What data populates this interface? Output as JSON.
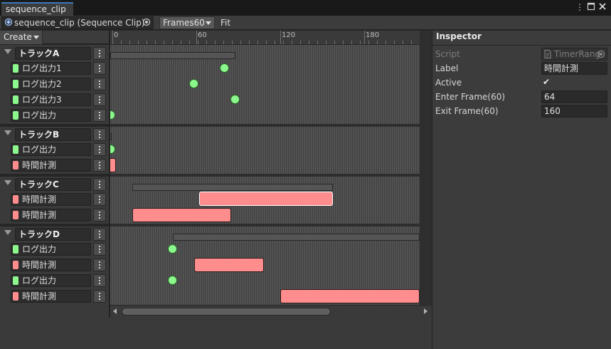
{
  "window": {
    "tab_title": "sequence_clip",
    "menu_icon": "kebab-menu-icon",
    "maximize_icon": "maximize-icon",
    "close_icon": "close-icon"
  },
  "toolbar": {
    "asset_field": "sequence_clip (Sequence Clip)",
    "frame_rate_dropdown": "Frames60",
    "fit_button": "Fit"
  },
  "left_header": {
    "create_button": "Create"
  },
  "ruler": {
    "ticks": [
      "0",
      "60",
      "120",
      "180"
    ]
  },
  "tracks": [
    {
      "name": "トラックA",
      "events": [
        {
          "label": "ログ出力1",
          "kind": "log",
          "color": "#8cf78c"
        },
        {
          "label": "ログ出力2",
          "kind": "log",
          "color": "#8cf78c"
        },
        {
          "label": "ログ出力3",
          "kind": "log",
          "color": "#8cf78c"
        },
        {
          "label": "ログ出力",
          "kind": "log",
          "color": "#8cf78c"
        }
      ]
    },
    {
      "name": "トラックB",
      "events": [
        {
          "label": "ログ出力",
          "kind": "log",
          "color": "#8cf78c"
        },
        {
          "label": "時間計測",
          "kind": "timer",
          "color": "#ff8d8d"
        }
      ]
    },
    {
      "name": "トラックC",
      "events": [
        {
          "label": "時間計測",
          "kind": "timer",
          "color": "#ff8d8d"
        },
        {
          "label": "時間計測",
          "kind": "timer",
          "color": "#ff8d8d"
        }
      ]
    },
    {
      "name": "トラックD",
      "events": [
        {
          "label": "ログ出力",
          "kind": "log",
          "color": "#8cf78c"
        },
        {
          "label": "時間計測",
          "kind": "timer",
          "color": "#ff8d8d"
        },
        {
          "label": "ログ出力",
          "kind": "log",
          "color": "#8cf78c"
        },
        {
          "label": "時間計測",
          "kind": "timer",
          "color": "#ff8d8d"
        }
      ]
    }
  ],
  "inspector": {
    "title": "Inspector",
    "script_label": "Script",
    "script_value": "TimerRang",
    "label_label": "Label",
    "label_value": "時間計測",
    "active_label": "Active",
    "active_checked": true,
    "check_mark": "✔",
    "enter_label": "Enter Frame(60)",
    "enter_value": "64",
    "exit_label": "Exit Frame(60)",
    "exit_value": "160"
  },
  "colors": {
    "log_event": "#8cf78c",
    "timer_event": "#ff8d8d",
    "accent_tab": "#3a79bb"
  }
}
